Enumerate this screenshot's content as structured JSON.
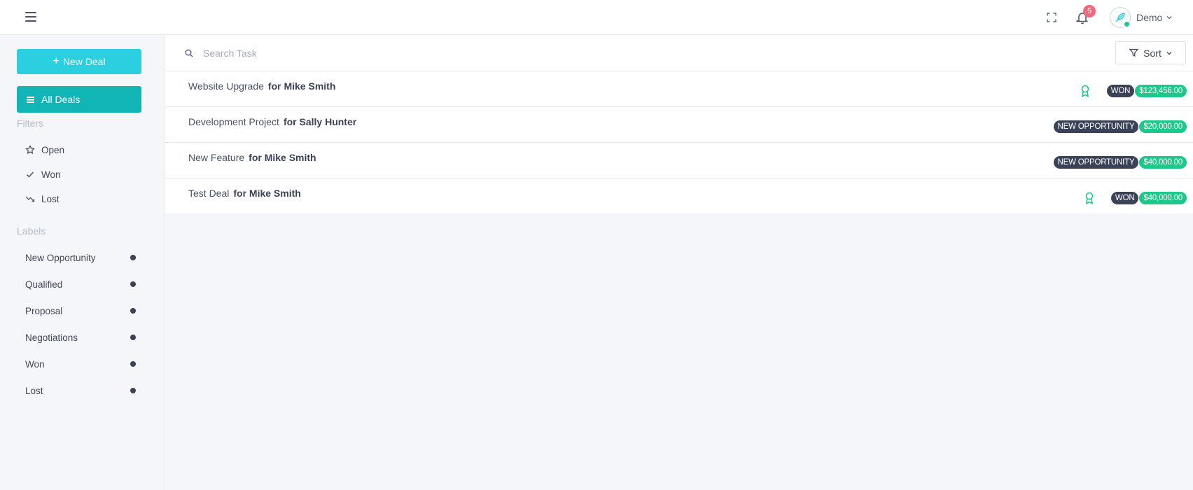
{
  "header": {
    "notification_count": "5",
    "user_name": "Demo"
  },
  "sidebar": {
    "new_deal_label": "New Deal",
    "all_deals_label": "All Deals",
    "filters_title": "Filters",
    "filters": [
      {
        "label": "Open",
        "icon": "star-icon"
      },
      {
        "label": "Won",
        "icon": "check-icon"
      },
      {
        "label": "Lost",
        "icon": "trending-down-icon"
      }
    ],
    "labels_title": "Labels",
    "labels": [
      {
        "label": "New Opportunity"
      },
      {
        "label": "Qualified"
      },
      {
        "label": "Proposal"
      },
      {
        "label": "Negotiations"
      },
      {
        "label": "Won"
      },
      {
        "label": "Lost"
      }
    ]
  },
  "search": {
    "placeholder": "Search Task",
    "value": ""
  },
  "sort": {
    "label": "Sort"
  },
  "deals": [
    {
      "title": "Website Upgrade",
      "for": "for Mike Smith",
      "stage": "WON",
      "amount": "$123,456.00",
      "won": true
    },
    {
      "title": "Development Project",
      "for": "for Sally Hunter",
      "stage": "NEW OPPORTUNITY",
      "amount": "$20,000.00",
      "won": false
    },
    {
      "title": "New Feature",
      "for": "for Mike Smith",
      "stage": "NEW OPPORTUNITY",
      "amount": "$40,000.00",
      "won": false
    },
    {
      "title": "Test Deal",
      "for": "for Mike Smith",
      "stage": "WON",
      "amount": "$40,000.00",
      "won": true
    }
  ],
  "colors": {
    "primary_button": "#2ccfe0",
    "active_nav": "#12b5b5",
    "won_amount": "#1cc88a",
    "stage_tag": "#3a4257",
    "badge": "#f06c7c"
  }
}
